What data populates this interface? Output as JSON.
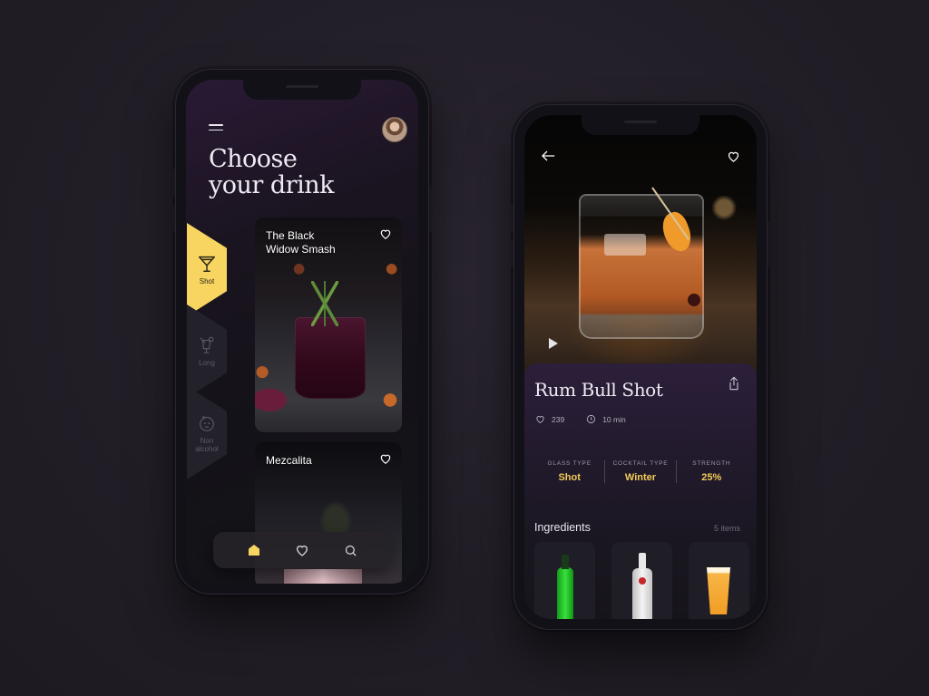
{
  "colors": {
    "accent_yellow": "#f7d560",
    "stat_value": "#f3cb58",
    "background": "#221e27"
  },
  "phone1": {
    "header": {
      "menu_icon": "hamburger-menu-icon",
      "avatar": "user-avatar",
      "title_line1": "Choose",
      "title_line2": "your drink"
    },
    "categories": [
      {
        "label": "Shot",
        "icon": "martini-glass-icon",
        "active": true
      },
      {
        "label": "Long",
        "icon": "long-drink-icon",
        "active": false
      },
      {
        "label_line1": "Non",
        "label_line2": "alcohol",
        "icon": "sober-face-icon",
        "active": false
      }
    ],
    "cards": [
      {
        "name_line1": "The Black",
        "name_line2": "Widow Smash",
        "icon": "heart-icon"
      },
      {
        "name_line1": "Mezcalita",
        "icon": "heart-icon"
      }
    ],
    "bottom_nav": [
      {
        "name": "home",
        "icon": "home-icon",
        "active": true
      },
      {
        "name": "favorites",
        "icon": "heart-icon",
        "active": false
      },
      {
        "name": "search",
        "icon": "search-icon",
        "active": false
      }
    ]
  },
  "phone2": {
    "header": {
      "back_icon": "arrow-left-icon",
      "favorite_icon": "heart-icon",
      "play_icon": "play-icon"
    },
    "drink": {
      "title": "Rum Bull Shot",
      "likes": "239",
      "time": "10 min",
      "share_icon": "share-icon"
    },
    "stats": [
      {
        "key": "GLASS TYPE",
        "value": "Shot"
      },
      {
        "key": "COCKTAIL TYPE",
        "value": "Winter"
      },
      {
        "key": "STRENGTH",
        "value": "25%"
      }
    ],
    "ingredients": {
      "title": "Ingredients",
      "count": "5 items",
      "items": [
        "green-liqueur-bottle",
        "white-rum-bottle",
        "beer-glass"
      ]
    }
  }
}
